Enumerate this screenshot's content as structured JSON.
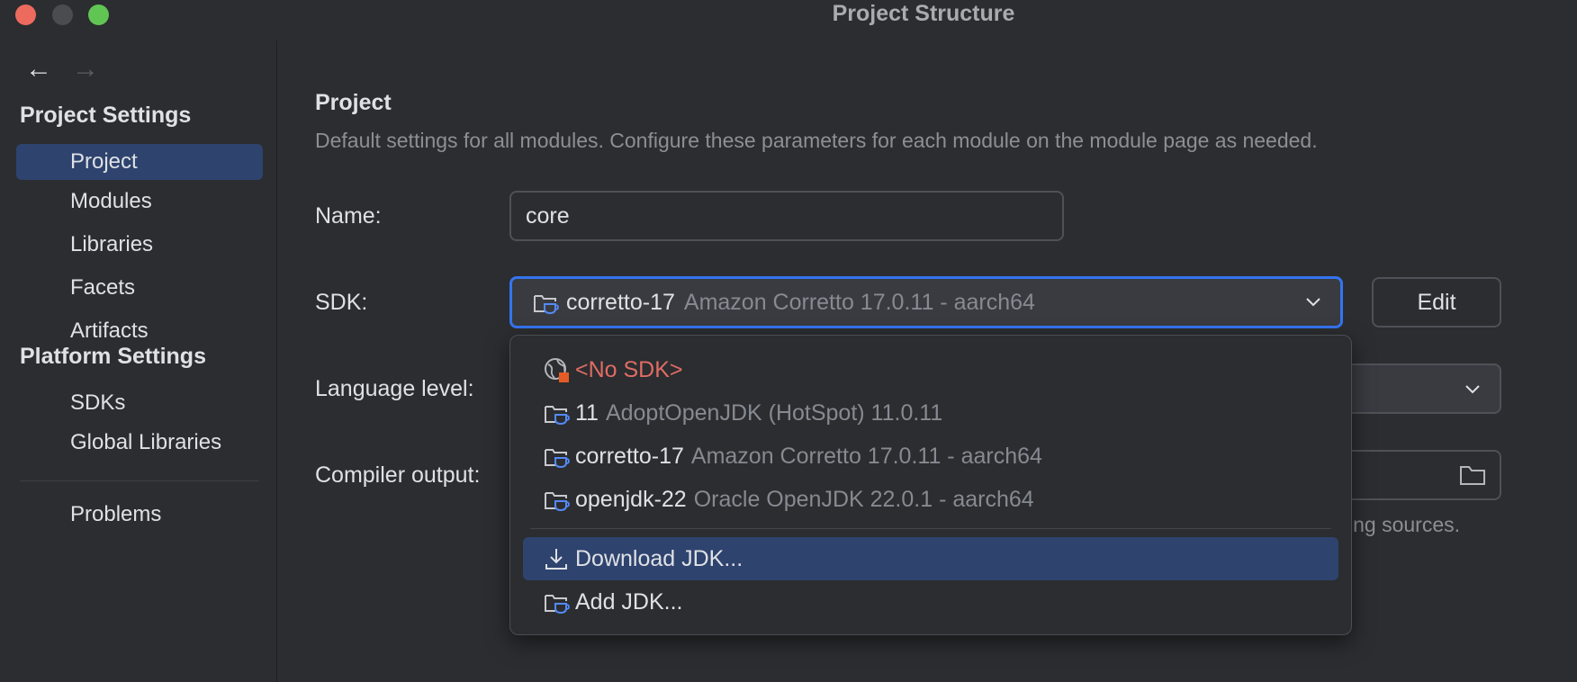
{
  "window": {
    "title": "Project Structure"
  },
  "sidebar": {
    "project_settings_title": "Project Settings",
    "platform_settings_title": "Platform Settings",
    "items": [
      {
        "label": "Project"
      },
      {
        "label": "Modules"
      },
      {
        "label": "Libraries"
      },
      {
        "label": "Facets"
      },
      {
        "label": "Artifacts"
      },
      {
        "label": "SDKs"
      },
      {
        "label": "Global Libraries"
      },
      {
        "label": "Problems"
      }
    ]
  },
  "main": {
    "title": "Project",
    "description": "Default settings for all modules. Configure these parameters for each module on the module page as needed.",
    "name_label": "Name:",
    "name_value": "core",
    "sdk_label": "SDK:",
    "sdk_selected_name": "corretto-17",
    "sdk_selected_desc": "Amazon Corretto 17.0.11 - aarch64",
    "edit_label": "Edit",
    "language_level_label": "Language level:",
    "compiler_output_label": "Compiler output:",
    "compiler_hint_fragment": "ing sources."
  },
  "dropdown": {
    "no_sdk": "<No SDK>",
    "options": [
      {
        "name": "11",
        "desc": "AdoptOpenJDK (HotSpot) 11.0.11"
      },
      {
        "name": "corretto-17",
        "desc": "Amazon Corretto 17.0.11 - aarch64"
      },
      {
        "name": "openjdk-22",
        "desc": "Oracle OpenJDK 22.0.1 - aarch64"
      }
    ],
    "download_jdk": "Download JDK...",
    "add_jdk": "Add JDK..."
  },
  "colors": {
    "accent": "#3574f0",
    "selection": "#2e436e",
    "error": "#e06c64",
    "jdk_icon_blue": "#548af7"
  }
}
